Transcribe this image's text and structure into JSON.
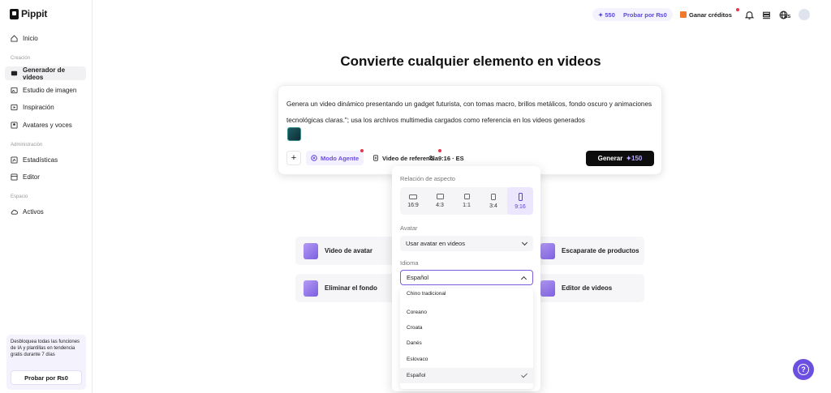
{
  "app": {
    "logo": "Pippit"
  },
  "sidebar": {
    "home": "Inicio",
    "section_creation": "Creación",
    "creation_items": [
      "Generador de videos",
      "Estudio de imagen",
      "Inspiración",
      "Avatares y voces"
    ],
    "section_admin": "Administración",
    "admin_items": [
      "Estadísticas",
      "Editor"
    ],
    "section_space": "Espacio",
    "space_items": [
      "Activos"
    ],
    "promo_text": "Desbloquea todas las funciones de IA y plantillas en tendencia gratis durante 7 días",
    "promo_button": "Probar por ₨0"
  },
  "header": {
    "credits": "✦ 550",
    "try_label": "Probar por ₨0",
    "earn_label": "Ganar créditos",
    "lang_badge": "ES"
  },
  "main": {
    "title": "Convierte cualquier elemento en videos",
    "prompt": "Genera un video dinámico presentando un gadget futurista, con tomas macro, brillos metálicos, fondo oscuro y animaciones tecnológicas claras.\"; usa los archivos multimedia cargados como referencia en los videos generados",
    "toolbar": {
      "plus": "+",
      "agent_mode": "Modo Agente",
      "reference_video": "Video de referencia",
      "ratio_lang": "9:16 · ES",
      "generate": "Generar",
      "generate_cost": "✦150"
    },
    "tiles": [
      "Video de avatar",
      "Eliminar el fondo",
      "Escaparate de productos",
      "Editor de videos"
    ]
  },
  "panel": {
    "aspect_label": "Relación de aspecto",
    "ratios": [
      "16:9",
      "4:3",
      "1:1",
      "3:4",
      "9:16"
    ],
    "selected_ratio": "9:16",
    "avatar_label": "Avatar",
    "avatar_value": "Usar avatar en videos",
    "language_label": "Idioma",
    "language_value": "Español",
    "language_options": [
      "Chino tradicional",
      "Coreano",
      "Croata",
      "Danés",
      "Eslovaco",
      "Español"
    ],
    "accent_color": "#7b5fe0"
  },
  "help": {
    "label": "?"
  }
}
